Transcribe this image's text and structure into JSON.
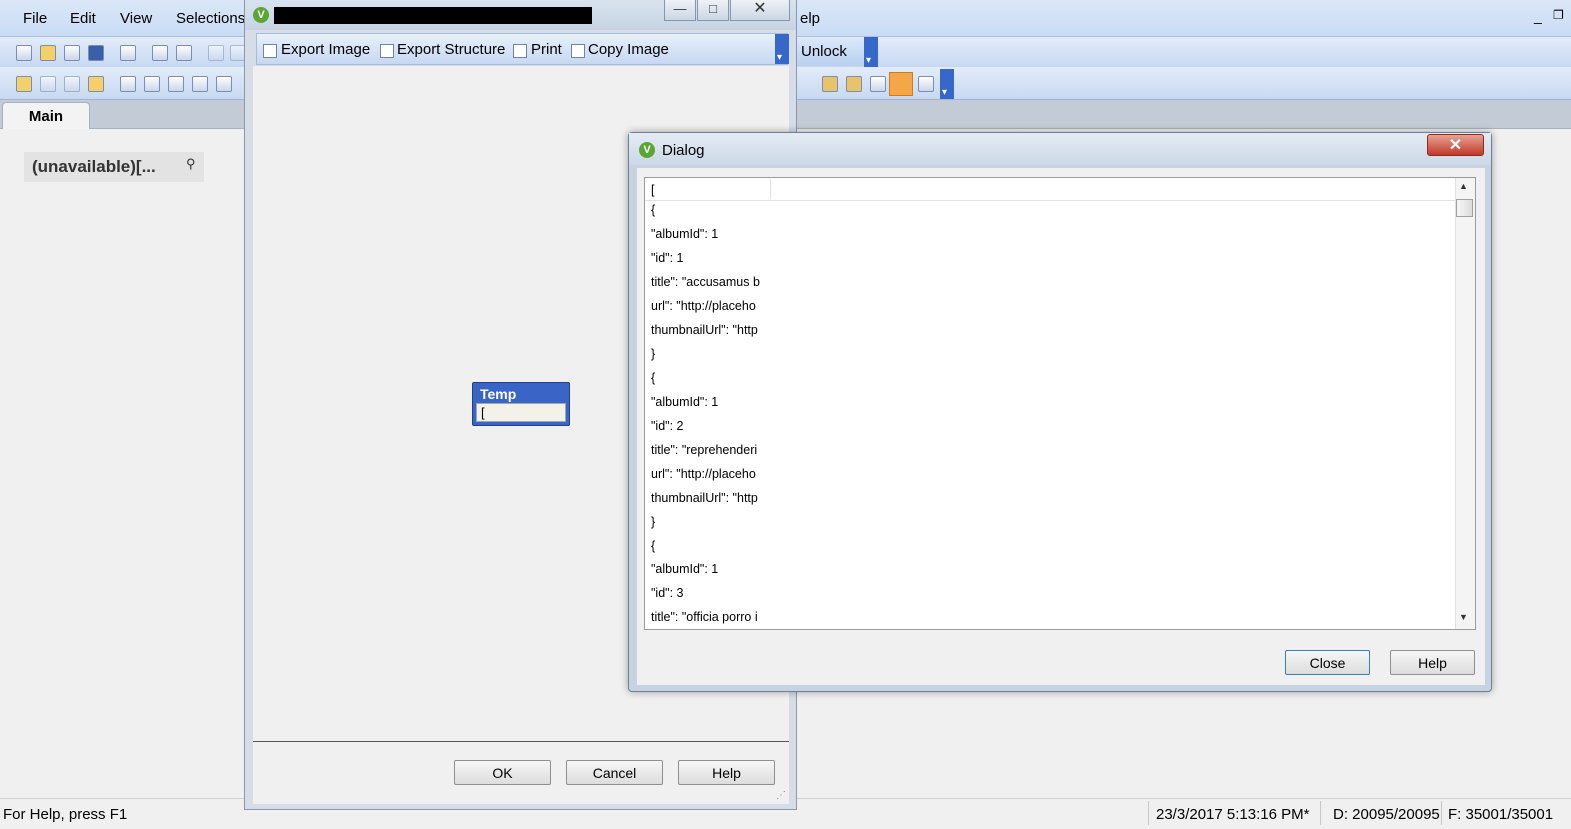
{
  "app": {
    "menu": [
      "File",
      "Edit",
      "View",
      "Selections",
      "elp"
    ],
    "unlock_label": "Unlock",
    "tab": "Main",
    "listbox_caption": "(unavailable)[...",
    "status": {
      "help": "For Help, press F1",
      "timestamp": "23/3/2017 5:13:16 PM*",
      "d_count": "D: 20095/20095",
      "f_count": "F: 35001/35001"
    }
  },
  "structure_window": {
    "toolbar": {
      "export_image": "Export Image",
      "export_structure": "Export Structure",
      "print": "Print",
      "copy_image": "Copy Image"
    },
    "table_box": {
      "title": "Temp",
      "field": "["
    },
    "buttons": {
      "ok": "OK",
      "cancel": "Cancel",
      "help": "Help"
    }
  },
  "dialog": {
    "title": "Dialog",
    "json_lines": [
      "[",
      "{",
      "\"albumId\": 1",
      "\"id\": 1",
      "title\": \"accusamus b",
      "url\": \"http://placeho",
      "thumbnailUrl\": \"http",
      "}",
      "{",
      "\"albumId\": 1",
      "\"id\": 2",
      "title\": \"reprehenderi",
      "url\": \"http://placeho",
      "thumbnailUrl\": \"http",
      "}",
      "{",
      "\"albumId\": 1",
      "\"id\": 3",
      "title\": \"officia porro i"
    ],
    "buttons": {
      "close": "Close",
      "help": "Help"
    }
  }
}
